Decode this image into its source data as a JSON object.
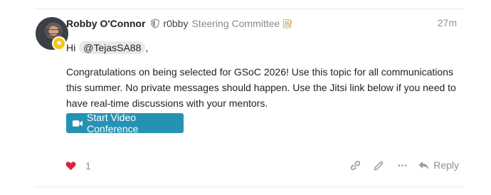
{
  "post": {
    "author": {
      "name": "Robby O'Connor",
      "handle": "r0bby",
      "title": "Steering Committee",
      "avatar_icon": "user-avatar",
      "flair_icon": "badge-flair-icon"
    },
    "time": "27m",
    "greeting": {
      "text": "Hi",
      "mention": "@TejasSA88",
      "suffix": ","
    },
    "body": "Congratulations on being selected for GSoC 2026! Use this topic for all communications this summer. No private messages should happen. Use the Jitsi link below if you need to have real-time discussions with your mentors.",
    "video_button": {
      "label": "Start Video Conference",
      "color": "#2592b4"
    }
  },
  "actions": {
    "like_count": "1",
    "reply_label": "Reply",
    "heart_color": "#e0203a",
    "icons": [
      "heart-icon",
      "link-icon",
      "edit-icon",
      "more-icon",
      "reply-icon"
    ]
  }
}
